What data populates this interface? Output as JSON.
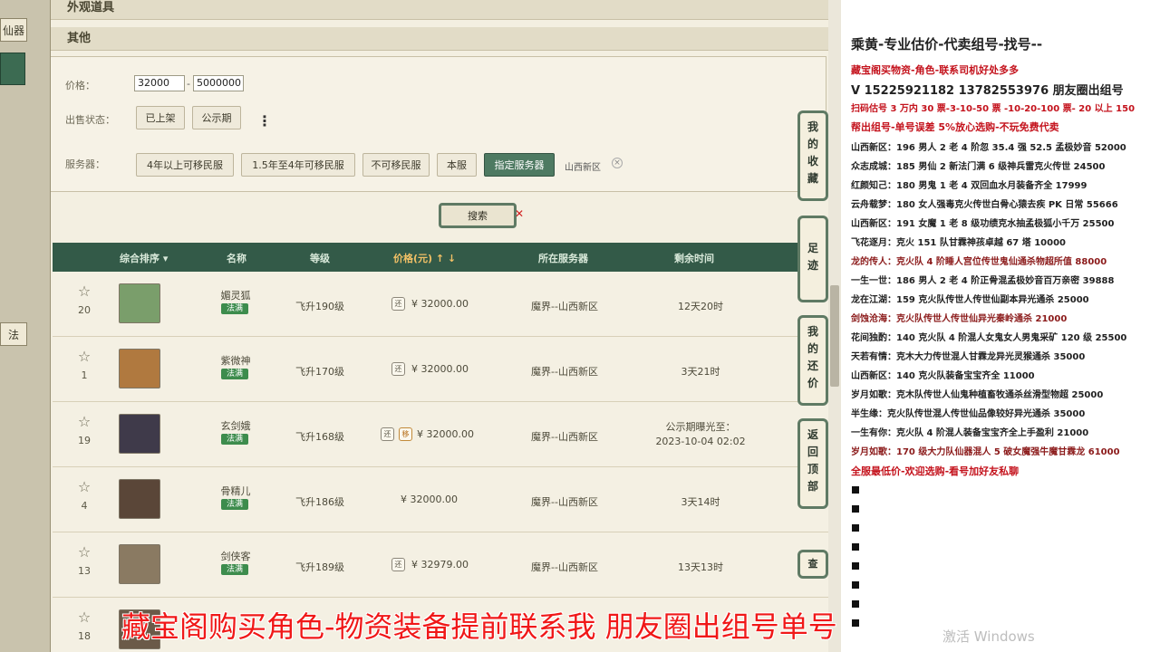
{
  "left_edge": {
    "tab_top": "仙器",
    "tab_mid": "法"
  },
  "sections": {
    "appearance": "外观道具",
    "other": "其他"
  },
  "filters": {
    "price_label": "价格：",
    "price_min": "32000",
    "price_max": "5000000",
    "status_label": "出售状态：",
    "status_options": [
      "已上架",
      "公示期"
    ],
    "more": "⋮",
    "server_label": "服务器：",
    "server_options": [
      "4年以上可移民服",
      "1.5年至4年可移民服",
      "不可移民服",
      "本服",
      "指定服务器"
    ],
    "server_selected": "山西新区",
    "clear": "×",
    "search": "搜索"
  },
  "table": {
    "headers": {
      "sort": "综合排序 ▾",
      "name": "名称",
      "level": "等级",
      "price": "价格(元) ↑ ↓",
      "server": "所在服务器",
      "remain": "剩余时间"
    },
    "rows": [
      {
        "rank": "20",
        "name": "媚灵狐",
        "tag": "法满",
        "level": "飞升190级",
        "icons": [
          "还"
        ],
        "price": "¥ 32000.00",
        "server": "魔界--山西新区",
        "remain": "12天20时",
        "avatar_color": "#7a9e6b"
      },
      {
        "rank": "1",
        "name": "紫微神",
        "tag": "法满",
        "level": "飞升170级",
        "icons": [
          "还"
        ],
        "price": "¥ 32000.00",
        "server": "魔界--山西新区",
        "remain": "3天21时",
        "avatar_color": "#b0793f"
      },
      {
        "rank": "19",
        "name": "玄剑娥",
        "tag": "法满",
        "level": "飞升168级",
        "icons": [
          "还",
          "移"
        ],
        "price": "¥ 32000.00",
        "server": "魔界--山西新区",
        "remain": "公示期曝光至：\n2023-10-04 02:02",
        "avatar_color": "#3f3a4a"
      },
      {
        "rank": "4",
        "name": "骨精儿",
        "tag": "法满",
        "level": "飞升186级",
        "icons": [],
        "price": "¥ 32000.00",
        "server": "魔界--山西新区",
        "remain": "3天14时",
        "avatar_color": "#5a4638"
      },
      {
        "rank": "13",
        "name": "剑侠客",
        "tag": "法满",
        "level": "飞升189级",
        "icons": [
          "还"
        ],
        "price": "¥ 32979.00",
        "server": "魔界--山西新区",
        "remain": "13天13时",
        "avatar_color": "#8a7a62"
      },
      {
        "rank": "18",
        "name": "",
        "tag": "",
        "level": "",
        "icons": [],
        "price": "",
        "server": "",
        "remain": "",
        "avatar_color": "#6b5a48"
      }
    ]
  },
  "side_buttons": [
    "我的收藏",
    "足迹",
    "我的还价",
    "返回顶部"
  ],
  "side_peek": "查",
  "chat": {
    "lines": [
      {
        "text": "乘黄-专业估价-代卖组号-找号--",
        "style": "big"
      },
      {
        "text": "藏宝阁买物资-角色-联系司机好处多多",
        "style": "red"
      },
      {
        "text": "V 15225921182   13782553976 朋友圈出组号",
        "style": "mid"
      },
      {
        "text": "扫码估号 3 万内 30 票-3-10-50 票  -10-20-100 票- 20 以上 150",
        "style": "red"
      },
      {
        "text": "帮出组号-单号误差 5%放心选购-不玩免费代卖",
        "style": "red"
      },
      {
        "text": "山西新区：196 男人 2 老 4 阶忽 35.4 强 52.5 孟极妙音 52000",
        "style": ""
      },
      {
        "text": "众志成城：185 男仙 2 新法门满 6 级神兵雷克火传世 24500",
        "style": ""
      },
      {
        "text": "红颜知己：180 男鬼 1 老 4 双回血水月装备齐全 17999",
        "style": ""
      },
      {
        "text": "云舟载梦：180 女人强毒克火传世白骨心猿去疾 PK 日常 55666",
        "style": ""
      },
      {
        "text": "山西新区：191 女魔 1 老 8 级功绩克水抽孟极狐小千万 25500",
        "style": ""
      },
      {
        "text": "飞花逐月：克火 151 队甘霖神孩卓越 67 塔 10000",
        "style": ""
      },
      {
        "text": "龙的传人：克火队 4 阶睡人宫位传世鬼仙通杀物超所值 88000",
        "style": "maroon"
      },
      {
        "text": "一生一世：186 男人 2 老 4 阶正骨混孟极妙音百万亲密 39888",
        "style": ""
      },
      {
        "text": "龙在江湖：159 克火队传世人传世仙副本异光通杀 25000",
        "style": ""
      },
      {
        "text": "剑蚀沧海：克火队传世人传世仙异光秦岭通杀 21000",
        "style": "maroon"
      },
      {
        "text": "花间独酌：140 克火队 4 阶混人女鬼女人男鬼采矿 120 级 25500",
        "style": ""
      },
      {
        "text": "天若有情：克木大力传世混人甘霖龙异光灵猴通杀 35000",
        "style": ""
      },
      {
        "text": "山西新区：140 克火队装备宝宝齐全 11000",
        "style": ""
      },
      {
        "text": "岁月如歌：克木队传世人仙鬼种植畜牧通杀丝滑型物超 25000",
        "style": ""
      },
      {
        "text": "半生缘：克火队传世混人传世仙品像较好异光通杀 35000",
        "style": ""
      },
      {
        "text": "一生有你：克火队 4 阶混人装备宝宝齐全上手盈利 21000",
        "style": ""
      },
      {
        "text": "岁月如歌：170 级大力队仙器混人 5 破女魔强牛魔甘霖龙 61000",
        "style": "maroon"
      },
      {
        "text": "全服最低价-欢迎选购-看号加好友私聊",
        "style": "red"
      }
    ]
  },
  "watermark": "激活 Windows",
  "caption": "藏宝阁购买角色-物资装备提前联系我     朋友圈出组号单号"
}
